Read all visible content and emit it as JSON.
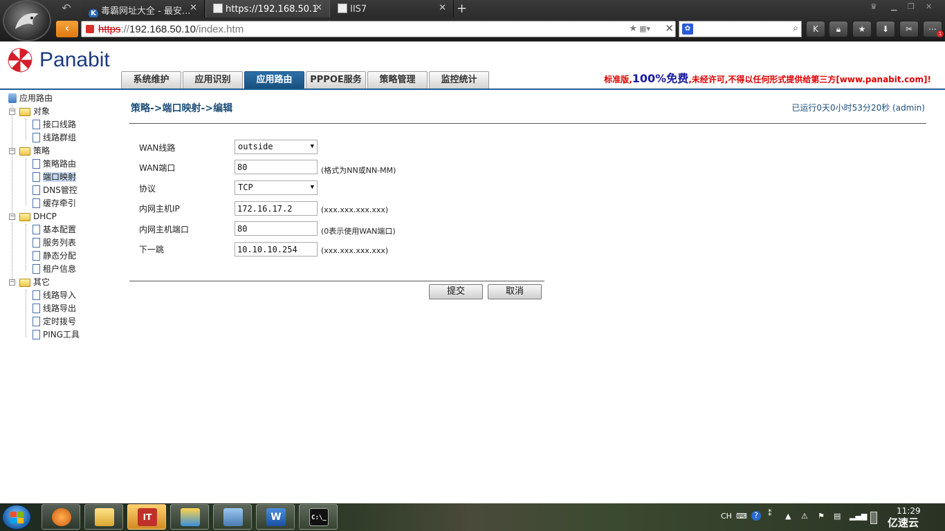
{
  "browser": {
    "tabs": [
      {
        "label": "毒霸网址大全 - 最安...",
        "icon": "k-icon",
        "active": false
      },
      {
        "label": "https://192.168.50.1",
        "icon": "document-icon",
        "active": true
      },
      {
        "label": "IIS7",
        "icon": "document-icon",
        "active": false
      }
    ],
    "new_tab_label": "+",
    "url": {
      "scheme": "https",
      "rest": "://",
      "host": "192.168.50.10",
      "path": "/index.htm"
    }
  },
  "brand": {
    "name": "Panabit"
  },
  "main_tabs": [
    {
      "label": "系统维护",
      "active": false
    },
    {
      "label": "应用识别",
      "active": false
    },
    {
      "label": "应用路由",
      "active": true
    },
    {
      "label": "PPPOE服务",
      "active": false
    },
    {
      "label": "策略管理",
      "active": false
    },
    {
      "label": "监控统计",
      "active": false
    }
  ],
  "edition_note": {
    "prefix": "标准版,",
    "highlight": "100%免费",
    "suffix": ",未经许可,不得以任何形式提供给第三方[www.panabit.com]!"
  },
  "tree": {
    "root": "应用路由",
    "groups": [
      {
        "label": "对象",
        "items": [
          "接口线路",
          "线路群组"
        ]
      },
      {
        "label": "策略",
        "items": [
          "策略路由",
          "端口映射",
          "DNS管控",
          "缓存牵引"
        ]
      },
      {
        "label": "DHCP",
        "items": [
          "基本配置",
          "服务列表",
          "静态分配",
          "租户信息"
        ]
      },
      {
        "label": "其它",
        "items": [
          "线路导入",
          "线路导出",
          "定时拨号",
          "PING工具"
        ]
      }
    ],
    "selected": "端口映射"
  },
  "content": {
    "breadcrumb": "策略->端口映射->编辑",
    "uptime": "已运行0天0小时53分20秒 (admin)",
    "form": {
      "wan_line": {
        "label": "WAN线路",
        "value": "outside"
      },
      "wan_port": {
        "label": "WAN端口",
        "value": "80",
        "hint": "(格式为NN或NN-MM)"
      },
      "protocol": {
        "label": "协议",
        "value": "TCP"
      },
      "lan_ip": {
        "label": "内网主机IP",
        "value": "172.16.17.2",
        "hint": "(xxx.xxx.xxx.xxx)"
      },
      "lan_port": {
        "label": "内网主机端口",
        "value": "80",
        "hint": "(0表示使用WAN端口)"
      },
      "next_hop": {
        "label": "下一跳",
        "value": "10.10.10.254",
        "hint": "(xxx.xxx.xxx.xxx)"
      }
    },
    "submit_label": "提交",
    "cancel_label": "取消"
  },
  "taskbar": {
    "apps": [
      "browser",
      "explorer",
      "IT",
      "vm",
      "network",
      "word",
      "cmd"
    ],
    "tray_lang": "CH",
    "clock": "11:29",
    "watermark": "亿速云"
  },
  "colors": {
    "accent": "#1d5c92",
    "active_tab": "#1f5f94",
    "notice_red": "#dd0000",
    "notice_blue": "#1a1aa0"
  }
}
